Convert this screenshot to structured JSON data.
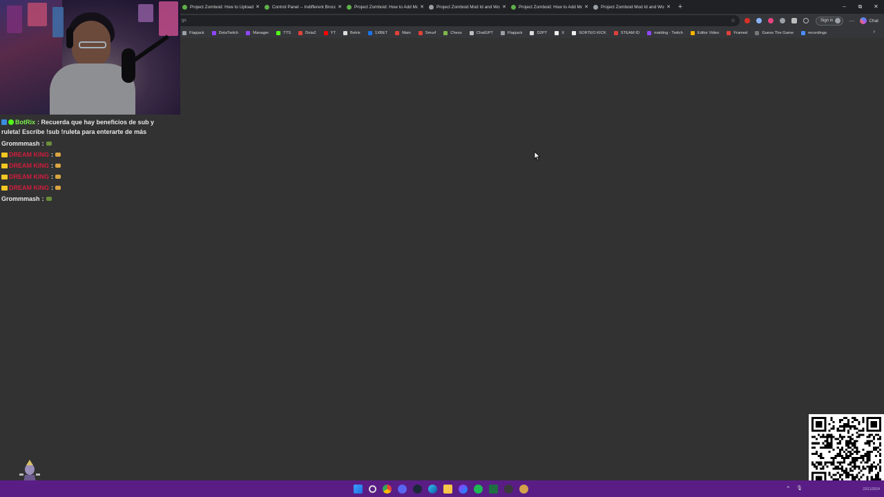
{
  "browser": {
    "tabs": [
      {
        "label": "Project Zomboid: How to Upload a",
        "favicon_color": "#5fb04b"
      },
      {
        "label": "Control Panel -- Indifferent Brocc",
        "favicon_color": "#5fb04b"
      },
      {
        "label": "Project Zomboid: How to Add Mo",
        "favicon_color": "#5fb04b"
      },
      {
        "label": "Project Zomboid Mod Id and Wor",
        "favicon_color": "#9aa0a6"
      },
      {
        "label": "Project Zomboid: How to Add Mo",
        "favicon_color": "#5fb04b"
      },
      {
        "label": "Project Zomboid Mod Id and Wor",
        "favicon_color": "#9aa0a6"
      }
    ],
    "new_tab_label": "+",
    "window_controls": {
      "minimize": "–",
      "restore": "⧉",
      "close": "✕"
    },
    "address_text": "gs",
    "sign_in_label": "Sign in",
    "chat_label": "Chat",
    "bookmarks": [
      {
        "label": "Flapjack",
        "color": "#9aa0a6"
      },
      {
        "label": "DotaTwitch",
        "color": "#9146ff"
      },
      {
        "label": "Manager",
        "color": "#9146ff"
      },
      {
        "label": "TTS",
        "color": "#53fc18"
      },
      {
        "label": "Dota2",
        "color": "#e0413a"
      },
      {
        "label": "YT",
        "color": "#ff0000"
      },
      {
        "label": "Botrix",
        "color": "#dddddd"
      },
      {
        "label": "1XBET",
        "color": "#1a73e8"
      },
      {
        "label": "Main",
        "color": "#e0413a"
      },
      {
        "label": "Smurf",
        "color": "#e0413a"
      },
      {
        "label": "Chess",
        "color": "#81b64c"
      },
      {
        "label": "ChatGPT",
        "color": "#bdbdbd"
      },
      {
        "label": "Flapjack",
        "color": "#9aa0a6"
      },
      {
        "label": "D2PT",
        "color": "#dddddd"
      },
      {
        "label": "X",
        "color": "#eeeeee"
      },
      {
        "label": "SORTEO KICK",
        "color": "#eeeeee"
      },
      {
        "label": "STEAM ID",
        "color": "#e0413a"
      },
      {
        "label": "malding - Twitch",
        "color": "#9146ff"
      },
      {
        "label": "Editor Video",
        "color": "#f4b400"
      },
      {
        "label": "Framed",
        "color": "#e0413a"
      },
      {
        "label": "Guess The Game",
        "color": "#777777"
      },
      {
        "label": "recordings",
        "color": "#4a8df8"
      }
    ]
  },
  "chat": {
    "bot_name": "BotRix",
    "bot_message": "Recuerda que hay beneficios de sub y ruleta! Escribe !sub !ruleta para enterarte de más",
    "separator": ":",
    "rows": [
      {
        "name": "Grommmash",
        "name_color": "#e8e8e8",
        "crown": false
      },
      {
        "name": "DREAM KING",
        "name_color": "#cf1d3c",
        "crown": true
      },
      {
        "name": "DREAM KING",
        "name_color": "#cf1d3c",
        "crown": true
      },
      {
        "name": "DREAM KING",
        "name_color": "#cf1d3c",
        "crown": true
      },
      {
        "name": "DREAM KING",
        "name_color": "#cf1d3c",
        "crown": true
      },
      {
        "name": "Grommmash",
        "name_color": "#e8e8e8",
        "crown": false
      }
    ]
  },
  "taskbar": {
    "icons": [
      "windows-start-icon",
      "search-icon",
      "chrome-icon",
      "discord-icon",
      "steam-icon",
      "edge-icon",
      "file-explorer-icon",
      "messenger-icon",
      "spotify-icon",
      "excel-icon",
      "media-icon",
      "obs-icon"
    ],
    "tray": [
      "^",
      "🎙"
    ],
    "clock": "22/11/2024"
  },
  "colors": {
    "page_bg": "#323232",
    "taskbar": "#5a1d86",
    "tab_strip": "#202124",
    "toolbar": "#35363a"
  }
}
